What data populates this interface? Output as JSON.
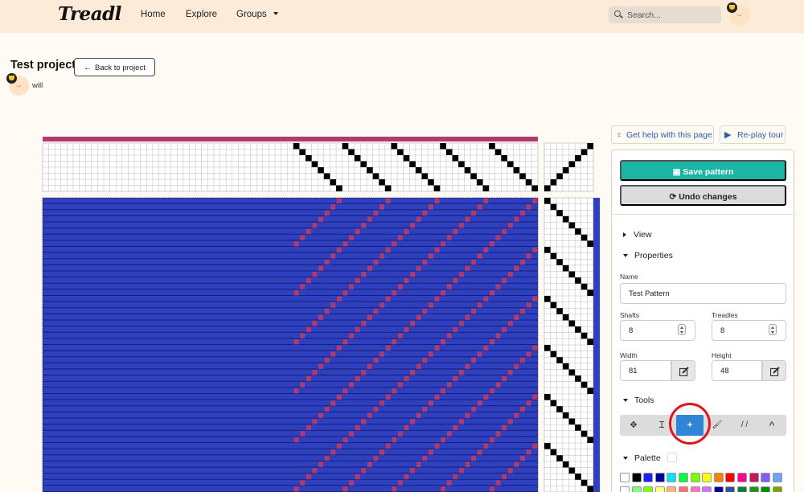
{
  "nav": {
    "logo": "Treadl",
    "links": [
      "Home",
      "Explore",
      "Groups"
    ],
    "search_placeholder": "Search..."
  },
  "project": {
    "title": "Test project",
    "back_label": "Back to project",
    "owner": "will"
  },
  "help": {
    "get_help": "Get help with this page",
    "replay_tour": "Re-play tour"
  },
  "actions": {
    "save": "Save pattern",
    "undo": "Undo changes"
  },
  "sections": {
    "view": "View",
    "properties": "Properties",
    "tools": "Tools",
    "palette": "Palette"
  },
  "properties": {
    "name_label": "Name",
    "name_value": "Test Pattern",
    "shafts_label": "Shafts",
    "shafts_value": "8",
    "treadles_label": "Treadles",
    "treadles_value": "8",
    "width_label": "Width",
    "width_value": "81",
    "height_label": "Height",
    "height_value": "48"
  },
  "tools": [
    {
      "name": "move",
      "glyph": "✥"
    },
    {
      "name": "cursor",
      "glyph": "Ɪ"
    },
    {
      "name": "add",
      "glyph": "+",
      "active": true
    },
    {
      "name": "paint",
      "glyph": "🖌"
    },
    {
      "name": "straight",
      "glyph": "/ /"
    },
    {
      "name": "point",
      "glyph": "^"
    }
  ],
  "colors": {
    "warp": "#b03a6e",
    "weft": "#2e3fbf",
    "accent": "#1bb5a6",
    "active_tool": "#2f86d6"
  },
  "palette_row1": [
    "#ffffff",
    "#000000",
    "#1f1fff",
    "#0000a0",
    "#00e5ff",
    "#00ff40",
    "#7cff00",
    "#ffff00",
    "#ff7f00",
    "#ff0000",
    "#ff0099",
    "#c2185b",
    "#7d5fff",
    "#6fa3ff"
  ],
  "palette_row2": [
    "#ffffff",
    "#7fff7f",
    "#7fff00",
    "#ffff7f",
    "#ffb07f",
    "#ff6f6f",
    "#ff6fc8",
    "#d36fff",
    "#0000a0",
    "#2f4f8f",
    "#007f3f",
    "#1f8f1f",
    "#008f00",
    "#7f9f00"
  ]
}
